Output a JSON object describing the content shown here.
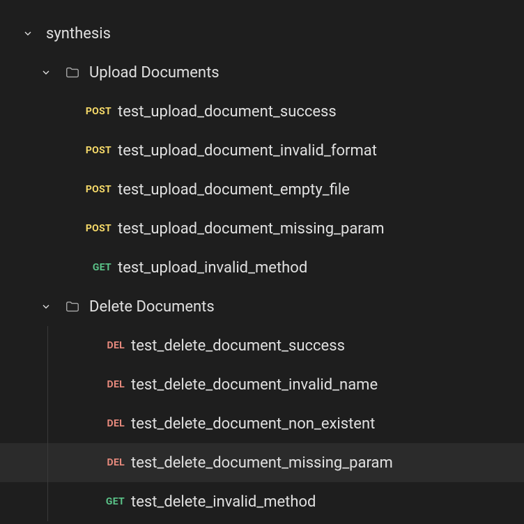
{
  "root": {
    "label": "synthesis"
  },
  "folders": [
    {
      "label": "Upload Documents",
      "requests": [
        {
          "method": "POST",
          "name": "test_upload_document_success"
        },
        {
          "method": "POST",
          "name": "test_upload_document_invalid_format"
        },
        {
          "method": "POST",
          "name": "test_upload_document_empty_file"
        },
        {
          "method": "POST",
          "name": "test_upload_document_missing_param"
        },
        {
          "method": "GET",
          "name": "test_upload_invalid_method"
        }
      ]
    },
    {
      "label": "Delete Documents",
      "requests": [
        {
          "method": "DEL",
          "name": "test_delete_document_success"
        },
        {
          "method": "DEL",
          "name": "test_delete_document_invalid_name"
        },
        {
          "method": "DEL",
          "name": "test_delete_document_non_existent"
        },
        {
          "method": "DEL",
          "name": "test_delete_document_missing_param"
        },
        {
          "method": "GET",
          "name": "test_delete_invalid_method"
        }
      ]
    }
  ],
  "selectedRequest": "test_delete_document_missing_param"
}
